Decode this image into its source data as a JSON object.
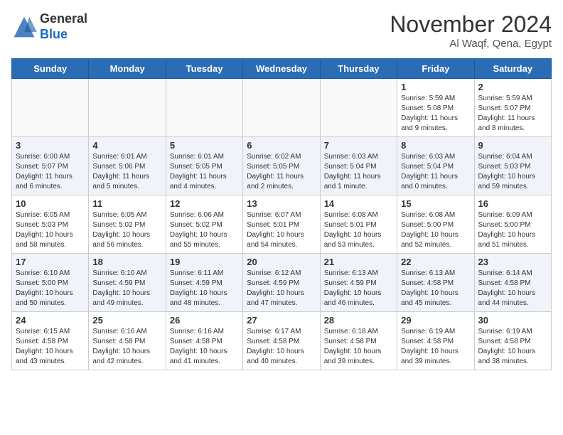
{
  "header": {
    "logo_general": "General",
    "logo_blue": "Blue",
    "month": "November 2024",
    "location": "Al Waqf, Qena, Egypt"
  },
  "days_of_week": [
    "Sunday",
    "Monday",
    "Tuesday",
    "Wednesday",
    "Thursday",
    "Friday",
    "Saturday"
  ],
  "weeks": [
    [
      {
        "day": "",
        "info": ""
      },
      {
        "day": "",
        "info": ""
      },
      {
        "day": "",
        "info": ""
      },
      {
        "day": "",
        "info": ""
      },
      {
        "day": "",
        "info": ""
      },
      {
        "day": "1",
        "info": "Sunrise: 5:59 AM\nSunset: 5:08 PM\nDaylight: 11 hours and 9 minutes."
      },
      {
        "day": "2",
        "info": "Sunrise: 5:59 AM\nSunset: 5:07 PM\nDaylight: 11 hours and 8 minutes."
      }
    ],
    [
      {
        "day": "3",
        "info": "Sunrise: 6:00 AM\nSunset: 5:07 PM\nDaylight: 11 hours and 6 minutes."
      },
      {
        "day": "4",
        "info": "Sunrise: 6:01 AM\nSunset: 5:06 PM\nDaylight: 11 hours and 5 minutes."
      },
      {
        "day": "5",
        "info": "Sunrise: 6:01 AM\nSunset: 5:05 PM\nDaylight: 11 hours and 4 minutes."
      },
      {
        "day": "6",
        "info": "Sunrise: 6:02 AM\nSunset: 5:05 PM\nDaylight: 11 hours and 2 minutes."
      },
      {
        "day": "7",
        "info": "Sunrise: 6:03 AM\nSunset: 5:04 PM\nDaylight: 11 hours and 1 minute."
      },
      {
        "day": "8",
        "info": "Sunrise: 6:03 AM\nSunset: 5:04 PM\nDaylight: 11 hours and 0 minutes."
      },
      {
        "day": "9",
        "info": "Sunrise: 6:04 AM\nSunset: 5:03 PM\nDaylight: 10 hours and 59 minutes."
      }
    ],
    [
      {
        "day": "10",
        "info": "Sunrise: 6:05 AM\nSunset: 5:03 PM\nDaylight: 10 hours and 58 minutes."
      },
      {
        "day": "11",
        "info": "Sunrise: 6:05 AM\nSunset: 5:02 PM\nDaylight: 10 hours and 56 minutes."
      },
      {
        "day": "12",
        "info": "Sunrise: 6:06 AM\nSunset: 5:02 PM\nDaylight: 10 hours and 55 minutes."
      },
      {
        "day": "13",
        "info": "Sunrise: 6:07 AM\nSunset: 5:01 PM\nDaylight: 10 hours and 54 minutes."
      },
      {
        "day": "14",
        "info": "Sunrise: 6:08 AM\nSunset: 5:01 PM\nDaylight: 10 hours and 53 minutes."
      },
      {
        "day": "15",
        "info": "Sunrise: 6:08 AM\nSunset: 5:00 PM\nDaylight: 10 hours and 52 minutes."
      },
      {
        "day": "16",
        "info": "Sunrise: 6:09 AM\nSunset: 5:00 PM\nDaylight: 10 hours and 51 minutes."
      }
    ],
    [
      {
        "day": "17",
        "info": "Sunrise: 6:10 AM\nSunset: 5:00 PM\nDaylight: 10 hours and 50 minutes."
      },
      {
        "day": "18",
        "info": "Sunrise: 6:10 AM\nSunset: 4:59 PM\nDaylight: 10 hours and 49 minutes."
      },
      {
        "day": "19",
        "info": "Sunrise: 6:11 AM\nSunset: 4:59 PM\nDaylight: 10 hours and 48 minutes."
      },
      {
        "day": "20",
        "info": "Sunrise: 6:12 AM\nSunset: 4:59 PM\nDaylight: 10 hours and 47 minutes."
      },
      {
        "day": "21",
        "info": "Sunrise: 6:13 AM\nSunset: 4:59 PM\nDaylight: 10 hours and 46 minutes."
      },
      {
        "day": "22",
        "info": "Sunrise: 6:13 AM\nSunset: 4:58 PM\nDaylight: 10 hours and 45 minutes."
      },
      {
        "day": "23",
        "info": "Sunrise: 6:14 AM\nSunset: 4:58 PM\nDaylight: 10 hours and 44 minutes."
      }
    ],
    [
      {
        "day": "24",
        "info": "Sunrise: 6:15 AM\nSunset: 4:58 PM\nDaylight: 10 hours and 43 minutes."
      },
      {
        "day": "25",
        "info": "Sunrise: 6:16 AM\nSunset: 4:58 PM\nDaylight: 10 hours and 42 minutes."
      },
      {
        "day": "26",
        "info": "Sunrise: 6:16 AM\nSunset: 4:58 PM\nDaylight: 10 hours and 41 minutes."
      },
      {
        "day": "27",
        "info": "Sunrise: 6:17 AM\nSunset: 4:58 PM\nDaylight: 10 hours and 40 minutes."
      },
      {
        "day": "28",
        "info": "Sunrise: 6:18 AM\nSunset: 4:58 PM\nDaylight: 10 hours and 39 minutes."
      },
      {
        "day": "29",
        "info": "Sunrise: 6:19 AM\nSunset: 4:58 PM\nDaylight: 10 hours and 39 minutes."
      },
      {
        "day": "30",
        "info": "Sunrise: 6:19 AM\nSunset: 4:58 PM\nDaylight: 10 hours and 38 minutes."
      }
    ]
  ]
}
